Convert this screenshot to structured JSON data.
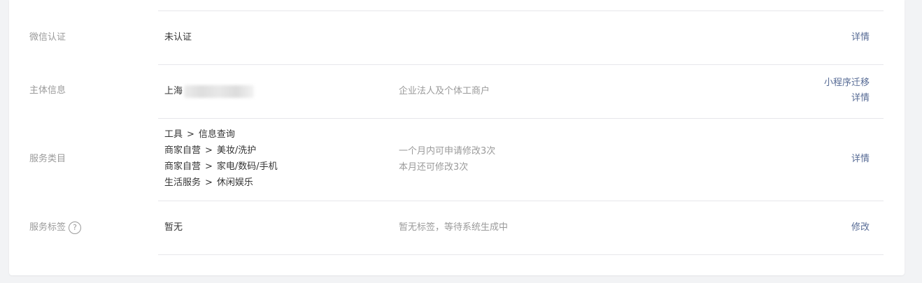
{
  "rows": {
    "wechat_verify": {
      "label": "微信认证",
      "value": "未认证",
      "action": "详情"
    },
    "entity_info": {
      "label": "主体信息",
      "value_prefix": "上海",
      "desc": "企业法人及个体工商户",
      "actions": [
        "小程序迁移",
        "详情"
      ]
    },
    "service_category": {
      "label": "服务类目",
      "categories": [
        {
          "parent": "工具",
          "separator": ">",
          "child": "信息查询"
        },
        {
          "parent": "商家自营",
          "separator": ">",
          "child": "美妆/洗护"
        },
        {
          "parent": "商家自营",
          "separator": ">",
          "child": "家电/数码/手机"
        },
        {
          "parent": "生活服务",
          "separator": ">",
          "child": "休闲娱乐"
        }
      ],
      "desc_lines": [
        "一个月内可申请修改3次",
        "本月还可修改3次"
      ],
      "action": "详情"
    },
    "service_tags": {
      "label": "服务标签",
      "help_icon": "question-circle-icon",
      "help_glyph": "?",
      "value": "暂无",
      "desc": "暂无标签，等待系统生成中",
      "action": "修改"
    }
  },
  "colors": {
    "link": "#576b95",
    "label": "#9a9a9a",
    "text": "#353535",
    "divider": "#e7e7eb",
    "background": "#f2f3f5"
  }
}
